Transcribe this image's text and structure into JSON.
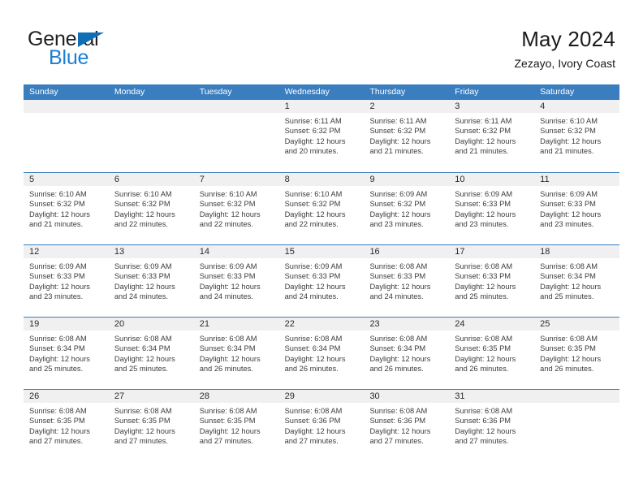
{
  "brand": {
    "name_top": "General",
    "name_bottom": "Blue",
    "accent_color": "#0f6eb5",
    "accent_color_light": "#1b7fd4",
    "triangle_icon": "triangle-icon"
  },
  "header": {
    "title": "May 2024",
    "subtitle": "Zezayo, Ivory Coast"
  },
  "theme": {
    "header_bg": "#3a7ebf",
    "day_number_bg": "#f0f0f0",
    "text_color": "#3c3c3c"
  },
  "weekdays": [
    "Sunday",
    "Monday",
    "Tuesday",
    "Wednesday",
    "Thursday",
    "Friday",
    "Saturday"
  ],
  "weeks": [
    [
      {
        "day": "",
        "empty": true
      },
      {
        "day": "",
        "empty": true
      },
      {
        "day": "",
        "empty": true
      },
      {
        "day": "1",
        "sunrise": "Sunrise: 6:11 AM",
        "sunset": "Sunset: 6:32 PM",
        "daylight_line1": "Daylight: 12 hours",
        "daylight_line2": "and 20 minutes."
      },
      {
        "day": "2",
        "sunrise": "Sunrise: 6:11 AM",
        "sunset": "Sunset: 6:32 PM",
        "daylight_line1": "Daylight: 12 hours",
        "daylight_line2": "and 21 minutes."
      },
      {
        "day": "3",
        "sunrise": "Sunrise: 6:11 AM",
        "sunset": "Sunset: 6:32 PM",
        "daylight_line1": "Daylight: 12 hours",
        "daylight_line2": "and 21 minutes."
      },
      {
        "day": "4",
        "sunrise": "Sunrise: 6:10 AM",
        "sunset": "Sunset: 6:32 PM",
        "daylight_line1": "Daylight: 12 hours",
        "daylight_line2": "and 21 minutes."
      }
    ],
    [
      {
        "day": "5",
        "sunrise": "Sunrise: 6:10 AM",
        "sunset": "Sunset: 6:32 PM",
        "daylight_line1": "Daylight: 12 hours",
        "daylight_line2": "and 21 minutes."
      },
      {
        "day": "6",
        "sunrise": "Sunrise: 6:10 AM",
        "sunset": "Sunset: 6:32 PM",
        "daylight_line1": "Daylight: 12 hours",
        "daylight_line2": "and 22 minutes."
      },
      {
        "day": "7",
        "sunrise": "Sunrise: 6:10 AM",
        "sunset": "Sunset: 6:32 PM",
        "daylight_line1": "Daylight: 12 hours",
        "daylight_line2": "and 22 minutes."
      },
      {
        "day": "8",
        "sunrise": "Sunrise: 6:10 AM",
        "sunset": "Sunset: 6:32 PM",
        "daylight_line1": "Daylight: 12 hours",
        "daylight_line2": "and 22 minutes."
      },
      {
        "day": "9",
        "sunrise": "Sunrise: 6:09 AM",
        "sunset": "Sunset: 6:32 PM",
        "daylight_line1": "Daylight: 12 hours",
        "daylight_line2": "and 23 minutes."
      },
      {
        "day": "10",
        "sunrise": "Sunrise: 6:09 AM",
        "sunset": "Sunset: 6:33 PM",
        "daylight_line1": "Daylight: 12 hours",
        "daylight_line2": "and 23 minutes."
      },
      {
        "day": "11",
        "sunrise": "Sunrise: 6:09 AM",
        "sunset": "Sunset: 6:33 PM",
        "daylight_line1": "Daylight: 12 hours",
        "daylight_line2": "and 23 minutes."
      }
    ],
    [
      {
        "day": "12",
        "sunrise": "Sunrise: 6:09 AM",
        "sunset": "Sunset: 6:33 PM",
        "daylight_line1": "Daylight: 12 hours",
        "daylight_line2": "and 23 minutes."
      },
      {
        "day": "13",
        "sunrise": "Sunrise: 6:09 AM",
        "sunset": "Sunset: 6:33 PM",
        "daylight_line1": "Daylight: 12 hours",
        "daylight_line2": "and 24 minutes."
      },
      {
        "day": "14",
        "sunrise": "Sunrise: 6:09 AM",
        "sunset": "Sunset: 6:33 PM",
        "daylight_line1": "Daylight: 12 hours",
        "daylight_line2": "and 24 minutes."
      },
      {
        "day": "15",
        "sunrise": "Sunrise: 6:09 AM",
        "sunset": "Sunset: 6:33 PM",
        "daylight_line1": "Daylight: 12 hours",
        "daylight_line2": "and 24 minutes."
      },
      {
        "day": "16",
        "sunrise": "Sunrise: 6:08 AM",
        "sunset": "Sunset: 6:33 PM",
        "daylight_line1": "Daylight: 12 hours",
        "daylight_line2": "and 24 minutes."
      },
      {
        "day": "17",
        "sunrise": "Sunrise: 6:08 AM",
        "sunset": "Sunset: 6:33 PM",
        "daylight_line1": "Daylight: 12 hours",
        "daylight_line2": "and 25 minutes."
      },
      {
        "day": "18",
        "sunrise": "Sunrise: 6:08 AM",
        "sunset": "Sunset: 6:34 PM",
        "daylight_line1": "Daylight: 12 hours",
        "daylight_line2": "and 25 minutes."
      }
    ],
    [
      {
        "day": "19",
        "sunrise": "Sunrise: 6:08 AM",
        "sunset": "Sunset: 6:34 PM",
        "daylight_line1": "Daylight: 12 hours",
        "daylight_line2": "and 25 minutes."
      },
      {
        "day": "20",
        "sunrise": "Sunrise: 6:08 AM",
        "sunset": "Sunset: 6:34 PM",
        "daylight_line1": "Daylight: 12 hours",
        "daylight_line2": "and 25 minutes."
      },
      {
        "day": "21",
        "sunrise": "Sunrise: 6:08 AM",
        "sunset": "Sunset: 6:34 PM",
        "daylight_line1": "Daylight: 12 hours",
        "daylight_line2": "and 26 minutes."
      },
      {
        "day": "22",
        "sunrise": "Sunrise: 6:08 AM",
        "sunset": "Sunset: 6:34 PM",
        "daylight_line1": "Daylight: 12 hours",
        "daylight_line2": "and 26 minutes."
      },
      {
        "day": "23",
        "sunrise": "Sunrise: 6:08 AM",
        "sunset": "Sunset: 6:34 PM",
        "daylight_line1": "Daylight: 12 hours",
        "daylight_line2": "and 26 minutes."
      },
      {
        "day": "24",
        "sunrise": "Sunrise: 6:08 AM",
        "sunset": "Sunset: 6:35 PM",
        "daylight_line1": "Daylight: 12 hours",
        "daylight_line2": "and 26 minutes."
      },
      {
        "day": "25",
        "sunrise": "Sunrise: 6:08 AM",
        "sunset": "Sunset: 6:35 PM",
        "daylight_line1": "Daylight: 12 hours",
        "daylight_line2": "and 26 minutes."
      }
    ],
    [
      {
        "day": "26",
        "sunrise": "Sunrise: 6:08 AM",
        "sunset": "Sunset: 6:35 PM",
        "daylight_line1": "Daylight: 12 hours",
        "daylight_line2": "and 27 minutes."
      },
      {
        "day": "27",
        "sunrise": "Sunrise: 6:08 AM",
        "sunset": "Sunset: 6:35 PM",
        "daylight_line1": "Daylight: 12 hours",
        "daylight_line2": "and 27 minutes."
      },
      {
        "day": "28",
        "sunrise": "Sunrise: 6:08 AM",
        "sunset": "Sunset: 6:35 PM",
        "daylight_line1": "Daylight: 12 hours",
        "daylight_line2": "and 27 minutes."
      },
      {
        "day": "29",
        "sunrise": "Sunrise: 6:08 AM",
        "sunset": "Sunset: 6:36 PM",
        "daylight_line1": "Daylight: 12 hours",
        "daylight_line2": "and 27 minutes."
      },
      {
        "day": "30",
        "sunrise": "Sunrise: 6:08 AM",
        "sunset": "Sunset: 6:36 PM",
        "daylight_line1": "Daylight: 12 hours",
        "daylight_line2": "and 27 minutes."
      },
      {
        "day": "31",
        "sunrise": "Sunrise: 6:08 AM",
        "sunset": "Sunset: 6:36 PM",
        "daylight_line1": "Daylight: 12 hours",
        "daylight_line2": "and 27 minutes."
      },
      {
        "day": "",
        "empty": true
      }
    ]
  ]
}
